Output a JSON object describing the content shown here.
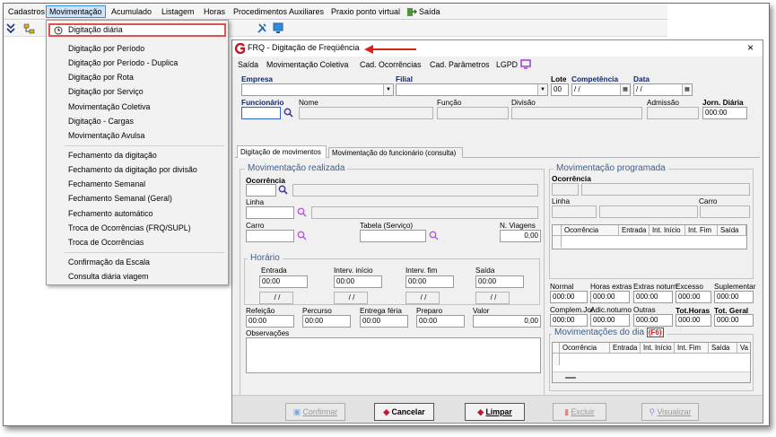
{
  "menubar": {
    "items": [
      "Cadastros",
      "Movimentação",
      "Acumulado",
      "Listagem",
      "Horas",
      "Procedimentos Auxiliares",
      "Praxio ponto virtual",
      "Saída"
    ]
  },
  "dropdown": {
    "items": [
      "Digitação diária",
      "Digitação por Período",
      "Digitação por Período - Duplica",
      "Digitação por Rota",
      "Digitação por Serviço",
      "Movimentação Coletiva",
      "Digitação - Cargas",
      "Movimentação Avulsa",
      "Fechamento da digitação",
      "Fechamento da digitação por divisão",
      "Fechamento Semanal",
      "Fechamento Semanal (Geral)",
      "Fechamento automático",
      "Troca de Ocorrências (FRQ/SUPL)",
      "Troca de Ocorrências",
      "Confirmação da Escala",
      "Consulta diária viagem"
    ]
  },
  "window": {
    "title": "FRQ - Digitação de Freqüência",
    "close": "×",
    "menu": [
      "Saída",
      "Movimentação Coletiva",
      "Cad. Ocorrências",
      "Cad. Parâmetros",
      "LGPD"
    ]
  },
  "header": {
    "empresa_label": "Empresa",
    "filial_label": "Filial",
    "lote_label": "Lote",
    "lote_value": "00",
    "competencia_label": "Competência",
    "competencia_value": " / /",
    "data_label": "Data",
    "data_value": " / /",
    "funcionario_label": "Funcionário",
    "nome_label": "Nome",
    "funcao_label": "Função",
    "divisao_label": "Divisão",
    "admissao_label": "Admissão",
    "jorn_label": "Jorn. Diária",
    "jorn_value": "000:00"
  },
  "tabs": [
    "Digitação de movimentos",
    "Movimentação do funcionário (consulta)"
  ],
  "realizada": {
    "title": "Movimentação realizada",
    "ocorrencia_label": "Ocorrência",
    "linha_label": "Linha",
    "carro_label": "Carro",
    "tabela_label": "Tabela (Serviço)",
    "viagens_label": "N. Viagens",
    "viagens_value": "0,00"
  },
  "horario": {
    "title": "Horário",
    "columns": [
      {
        "label": "Entrada",
        "time": "00:00",
        "date": "/ /"
      },
      {
        "label": "Interv. início",
        "time": "00:00",
        "date": "/ /"
      },
      {
        "label": "Interv. fim",
        "time": "00:00",
        "date": "/ /"
      },
      {
        "label": "Saída",
        "time": "00:00",
        "date": "/ /"
      }
    ]
  },
  "extras": [
    {
      "label": "Refeição",
      "value": "00:00"
    },
    {
      "label": "Percurso",
      "value": "00:00"
    },
    {
      "label": "Entrega féria",
      "value": "00:00"
    },
    {
      "label": "Preparo",
      "value": "00:00"
    },
    {
      "label": "Valor",
      "value": "0,00"
    }
  ],
  "observacoes_label": "Observações",
  "programada": {
    "title": "Movimentação programada",
    "ocorrencia_label": "Ocorrência",
    "linha_label": "Linha",
    "carro_label": "Carro",
    "grid_headers": [
      "Ocorrência",
      "Entrada",
      "Int. Início",
      "Int. Fim",
      "Saída"
    ]
  },
  "totals_row1": [
    {
      "label": "Normal",
      "value": "000:00"
    },
    {
      "label": "Horas extras",
      "value": "000:00"
    },
    {
      "label": "Extras noturn",
      "value": "000:00"
    },
    {
      "label": "Excesso",
      "value": "000:00"
    },
    {
      "label": "Suplementar",
      "value": "000:00"
    }
  ],
  "totals_row2": [
    {
      "label": "Complem.Jor.",
      "value": "000:00"
    },
    {
      "label": "Adic.noturno",
      "value": "000:00"
    },
    {
      "label": "Outras",
      "value": "000:00"
    },
    {
      "label": "Tot.Horas",
      "value": "000:00"
    },
    {
      "label": "Tot. Geral",
      "value": "000:00"
    }
  ],
  "movdia": {
    "title": "Movimentações do dia",
    "shortcut": "(F6)",
    "grid_headers": [
      "Ocorrência",
      "Entrada",
      "Int. Início",
      "Int. Fim",
      "Saída",
      "Va"
    ]
  },
  "buttons": {
    "confirmar": "Confirmar",
    "cancelar": "Cancelar",
    "limpar": "Limpar",
    "excluir": "Excluir",
    "visualizar": "Visualizar"
  },
  "colors": {
    "accent_red": "#d9211d",
    "title_blue": "#3c5e8c",
    "menu_active": "#cfe3f8"
  }
}
